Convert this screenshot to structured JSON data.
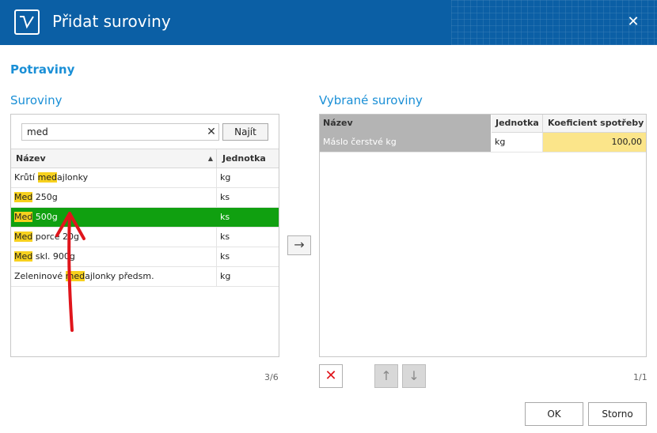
{
  "window": {
    "title": "Přidat suroviny",
    "close_glyph": "✕"
  },
  "section_title": "Potraviny",
  "left": {
    "title": "Suroviny",
    "search": {
      "value": "med",
      "clear_glyph": "✕",
      "find_label": "Najít"
    },
    "columns": [
      "Název",
      "Jednotka"
    ],
    "sort_glyph": "▲",
    "rows": [
      {
        "pre": "Krůtí ",
        "hl": "med",
        "post": "ajlonky",
        "unit": "kg",
        "selected": false
      },
      {
        "pre": "",
        "hl": "Med",
        "post": " 250g",
        "unit": "ks",
        "selected": false
      },
      {
        "pre": "",
        "hl": "Med",
        "post": " 500g",
        "unit": "ks",
        "selected": true
      },
      {
        "pre": "",
        "hl": "Med",
        "post": " porce 20g",
        "unit": "ks",
        "selected": false
      },
      {
        "pre": "",
        "hl": "Med",
        "post": " skl. 900g",
        "unit": "ks",
        "selected": false
      },
      {
        "pre": "Zeleninové ",
        "hl": "med",
        "post": "ajlonky  předsm.",
        "unit": "kg",
        "selected": false
      }
    ],
    "pager": "3/6"
  },
  "move_glyph": "→",
  "right": {
    "title": "Vybrané suroviny",
    "columns": [
      "Název",
      "Jednotka",
      "Koeficient spotřeby"
    ],
    "rows": [
      {
        "name": "Máslo čerstvé kg",
        "unit": "kg",
        "coef": "100,00"
      }
    ],
    "pager": "1/1"
  },
  "toolbar": {
    "delete_glyph": "✕",
    "up_glyph": "↑",
    "down_glyph": "↓"
  },
  "footer": {
    "ok_label": "OK",
    "cancel_label": "Storno"
  },
  "colors": {
    "titlebar": "#0b5fa5",
    "accent": "#1a8fd6",
    "selected_row": "#10a010",
    "highlight": "#f7d11e",
    "annotation": "#e0151c"
  }
}
